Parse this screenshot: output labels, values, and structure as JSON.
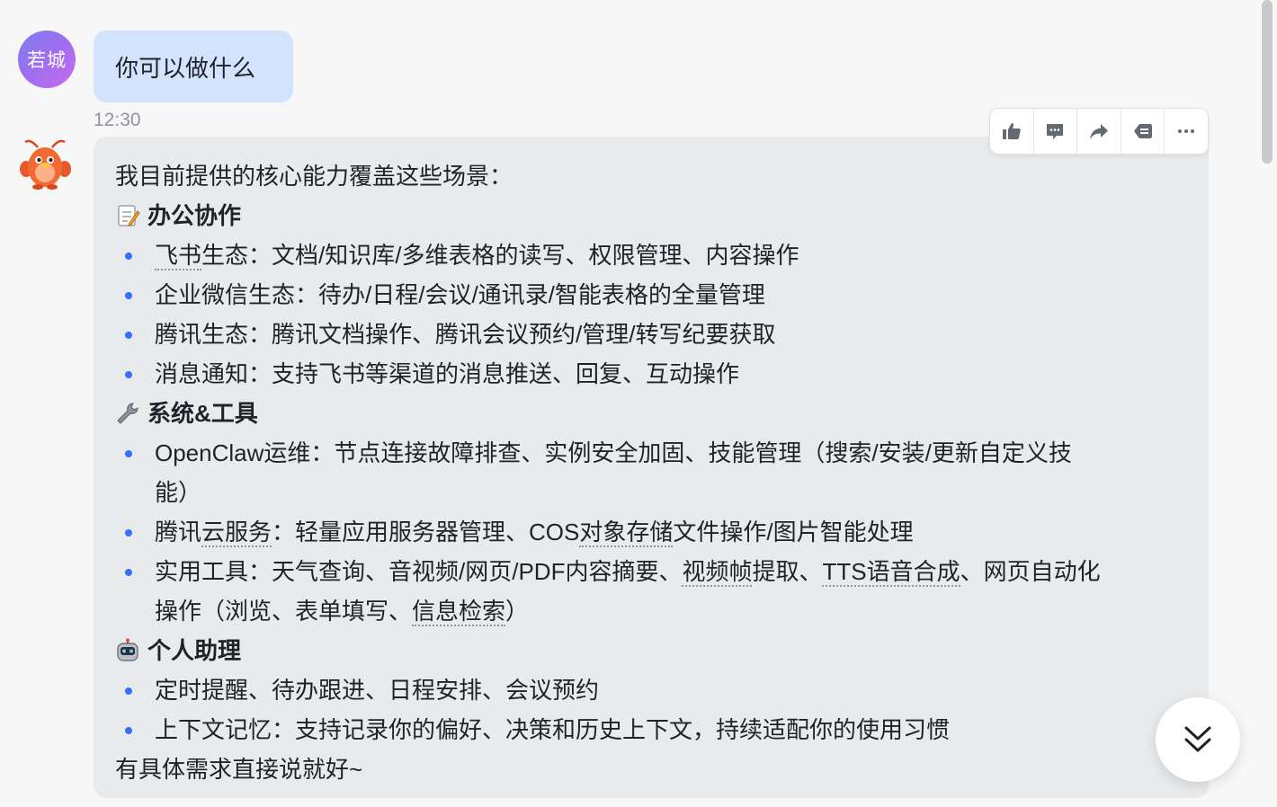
{
  "user_message": {
    "avatar_text": "若城",
    "text": "你可以做什么",
    "timestamp": "12:30"
  },
  "bot_message": {
    "intro": "我目前提供的核心能力覆盖这些场景：",
    "sections": [
      {
        "icon": "memo-icon",
        "title": "办公协作",
        "items": [
          [
            "飞书",
            "生态：文档/知识库/多维表格的读写、权限管理、内容操作"
          ],
          [
            "企业微信生态：待办/日程/会议/通讯录/智能表格的全量管理"
          ],
          [
            "腾讯生态：腾讯文档操作、腾讯会议预约/管理/转写纪要获取"
          ],
          [
            "消息通知：支持飞书等渠道的消息推送、回复、互动操作"
          ]
        ]
      },
      {
        "icon": "wrench-icon",
        "title": "系统&工具",
        "items": [
          [
            "OpenClaw运维：节点连接故障排查、实例安全加固、技能管理（搜索/安装/更新自定义技",
            "能）"
          ],
          [
            "腾讯",
            "云服务",
            "：轻量应用服务器管理、COS",
            "对象存储",
            "文件操作/图片智能处理"
          ],
          [
            "实用工具：天气查询、音视频/网页/PDF内容摘要、",
            "视频帧",
            "提取、",
            "TTS语音合成",
            "、网页自动化",
            "操作（浏览、表单填写、",
            "信息检索",
            "）"
          ]
        ]
      },
      {
        "icon": "robot-icon",
        "title": "个人助理",
        "items": [
          [
            "定时提醒、待办跟进、日程安排、会议预约"
          ],
          [
            "上下文记忆：支持记录你的偏好、决策和历史上下文，持续适配你的使用习惯"
          ]
        ]
      }
    ],
    "outro": "有具体需求直接说就好~"
  },
  "toolbar": {
    "buttons": [
      "thumbs-up-icon",
      "comment-icon",
      "forward-icon",
      "quote-icon",
      "more-icon"
    ]
  },
  "colors": {
    "user_bubble": "#d3e3fd",
    "bot_bubble": "#e9eaec",
    "bullet": "#3370ff",
    "avatar_gradient_start": "#7b7ef0",
    "avatar_gradient_end": "#c96cf0"
  }
}
